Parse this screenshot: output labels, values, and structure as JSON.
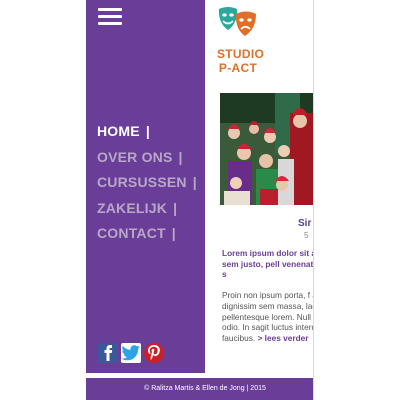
{
  "nav": {
    "items": [
      {
        "label": "HOME",
        "active": true
      },
      {
        "label": "OVER ONS",
        "active": false
      },
      {
        "label": "CURSUSSEN",
        "active": false
      },
      {
        "label": "ZAKELIJK",
        "active": false
      },
      {
        "label": "CONTACT",
        "active": false
      }
    ],
    "separator": "|"
  },
  "logo": {
    "line1": "STUDIO",
    "line2": "P-ACT",
    "mask_colors": [
      "#2aa89a",
      "#e06f2a"
    ]
  },
  "post": {
    "title": "Sir",
    "date": "5",
    "intro": "Lorem ipsum dolor sit am elit.Nunc sem justo, pell venenatis, fermentum s",
    "body": "Proin non ipsum porta, f ante. Vivamus dignissim sem massa, laoreet port pellentesque lorem. Null ipsum vitae odio. In sagit luctus interdum. In sagit faucibus.",
    "read_more": "> lees verder"
  },
  "social": [
    "facebook-icon",
    "twitter-icon",
    "pinterest-icon"
  ],
  "footer": {
    "text": "© Ralitza Martis & Ellen de Jong  |  2015"
  },
  "colors": {
    "brand_purple": "#6a3e98",
    "nav_inactive": "#b8a8c6",
    "logo_orange": "#e06f2a",
    "logo_teal": "#2aa89a"
  }
}
